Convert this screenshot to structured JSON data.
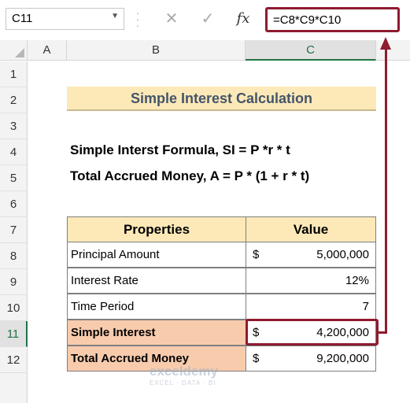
{
  "formula_bar": {
    "name_box": "C11",
    "cancel_icon": "✕",
    "enter_icon": "✓",
    "fx_label": "fx",
    "formula": "=C8*C9*C10"
  },
  "columns": [
    "A",
    "B",
    "C"
  ],
  "rows": [
    "1",
    "2",
    "3",
    "4",
    "5",
    "6",
    "7",
    "8",
    "9",
    "10",
    "11",
    "12"
  ],
  "sheet": {
    "title": "Simple Interest Calculation",
    "formula1": "Simple Interst Formula, SI = P *r * t",
    "formula2": "Total Accrued Money, A = P * (1 + r * t)",
    "table": {
      "header_property": "Properties",
      "header_value": "Value",
      "rows": [
        {
          "label": "Principal Amount",
          "currency": "$",
          "value": "5,000,000"
        },
        {
          "label": "Interest Rate",
          "currency": "",
          "value": "12%"
        },
        {
          "label": "Time Period",
          "currency": "",
          "value": "7"
        },
        {
          "label": "Simple Interest",
          "currency": "$",
          "value": "4,200,000"
        },
        {
          "label": "Total Accrued Money",
          "currency": "$",
          "value": "9,200,000"
        }
      ]
    }
  },
  "watermark": {
    "name": "exceldemy",
    "tagline": "EXCEL · DATA · BI"
  },
  "colors": {
    "highlight": "#f8cbad",
    "header_fill": "#fde9b8",
    "callout": "#8e1b2f",
    "excel_green": "#217346"
  }
}
